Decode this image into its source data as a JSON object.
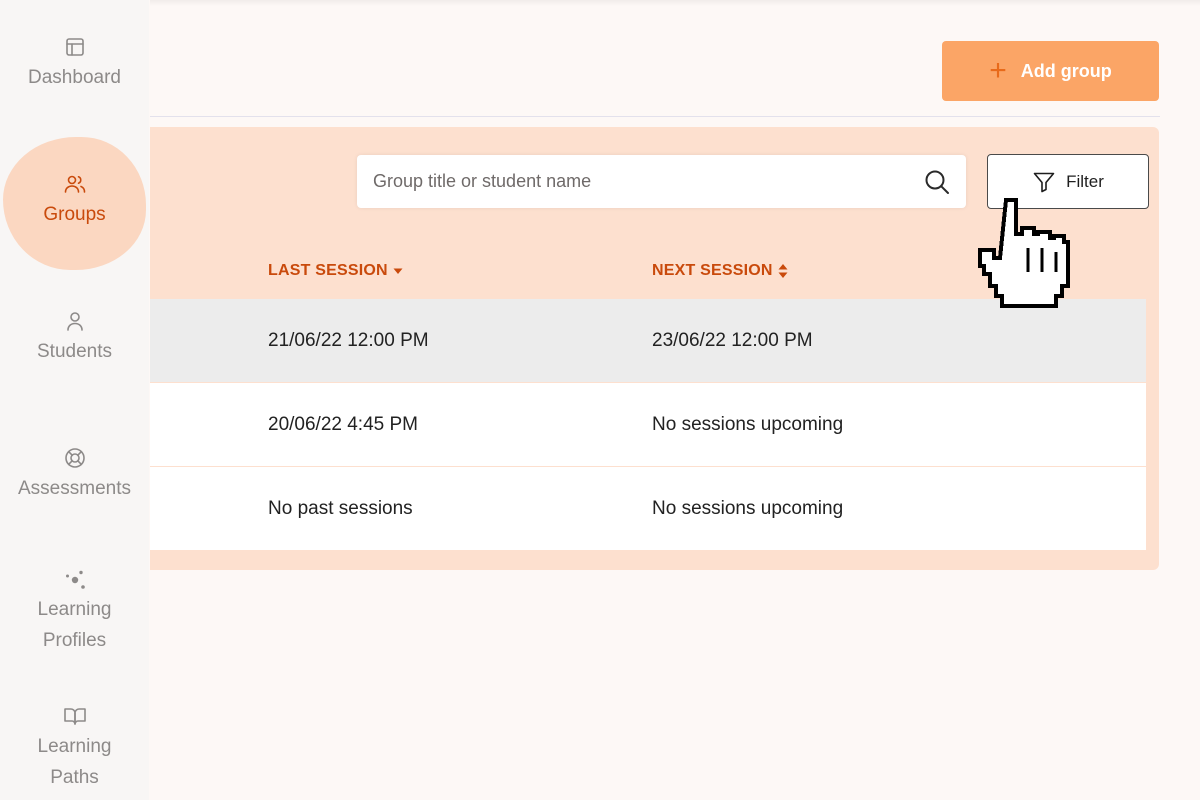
{
  "sidebar": {
    "items": [
      {
        "label": "Dashboard",
        "icon": "layout-icon"
      },
      {
        "label": "Groups",
        "icon": "users-icon",
        "active": true
      },
      {
        "label": "Students",
        "icon": "user-icon"
      },
      {
        "label": "Assessments",
        "icon": "lifebuoy-icon"
      },
      {
        "label": "Learning Profiles",
        "icon": "dots-icon"
      },
      {
        "label": "Learning Paths",
        "icon": "book-open-icon"
      }
    ]
  },
  "toolbar": {
    "add_label": "Add group",
    "add_icon": "plus-icon"
  },
  "search": {
    "placeholder": "Group title or student name",
    "icon": "search-icon"
  },
  "filter": {
    "label": "Filter",
    "icon": "funnel-icon"
  },
  "table": {
    "columns": [
      {
        "label": "LAST SESSION",
        "sort": "desc"
      },
      {
        "label": "NEXT SESSION",
        "sort": "none"
      }
    ],
    "rows": [
      {
        "last": "21/06/22 12:00 PM",
        "next": "23/06/22 12:00 PM"
      },
      {
        "last": "20/06/22 4:45 PM",
        "next": "No sessions upcoming"
      },
      {
        "last": "No past sessions",
        "next": "No sessions upcoming"
      }
    ]
  },
  "colors": {
    "accent": "#c94a0c",
    "button": "#fba566",
    "panel": "#fde0cf",
    "active_blob": "#fbd7c1"
  },
  "cursor": "pointer-hand-icon"
}
